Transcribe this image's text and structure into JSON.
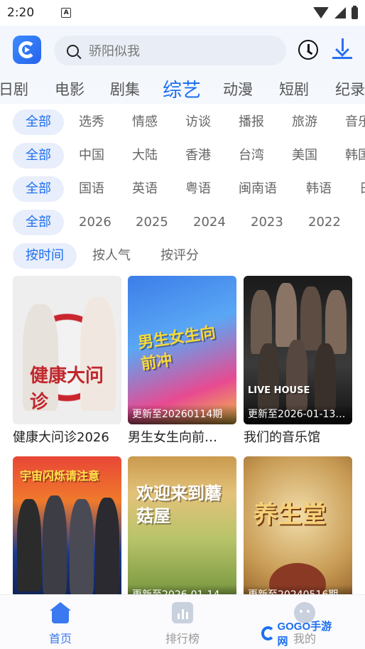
{
  "status_bar": {
    "time": "2:20"
  },
  "search": {
    "placeholder": "骄阳似我"
  },
  "category_tabs": [
    "日剧",
    "电影",
    "剧集",
    "综艺",
    "动漫",
    "短剧",
    "纪录"
  ],
  "active_category": "综艺",
  "filters": {
    "type": [
      "全部",
      "选秀",
      "情感",
      "访谈",
      "播报",
      "旅游",
      "音乐"
    ],
    "region": [
      "全部",
      "中国",
      "大陆",
      "香港",
      "台湾",
      "美国",
      "韩国"
    ],
    "language": [
      "全部",
      "国语",
      "英语",
      "粤语",
      "闽南语",
      "韩语",
      "日语"
    ],
    "year": [
      "全部",
      "2026",
      "2025",
      "2024",
      "2023",
      "2022"
    ],
    "sort": [
      "按时间",
      "按人气",
      "按评分"
    ]
  },
  "cards": [
    {
      "title": "健康大问诊2026",
      "caption": "",
      "poster_text": "健康大问诊"
    },
    {
      "title": "男生女生向前…",
      "caption": "更新至20260114期",
      "poster_text": "男生女生向前冲"
    },
    {
      "title": "我们的音乐馆",
      "caption": "更新至2026-01-13…",
      "poster_text": "LIVE HOUSE"
    },
    {
      "title": "",
      "caption": "",
      "poster_text": "宇宙闪烁请注意"
    },
    {
      "title": "",
      "caption": "更新至2026-01-14",
      "poster_text": "欢迎来到蘑菇屋"
    },
    {
      "title": "",
      "caption": "更新至20240516期",
      "poster_text": "养生堂"
    }
  ],
  "bottom_nav": [
    {
      "label": "首页",
      "icon": "home-icon",
      "active": true
    },
    {
      "label": "排行榜",
      "icon": "ranking-icon",
      "active": false
    },
    {
      "label": "我的",
      "icon": "profile-icon",
      "active": false
    }
  ],
  "watermark": "GOGO手游网",
  "colors": {
    "accent": "#1e6ff0",
    "chip_bg": "#e8eefb"
  }
}
